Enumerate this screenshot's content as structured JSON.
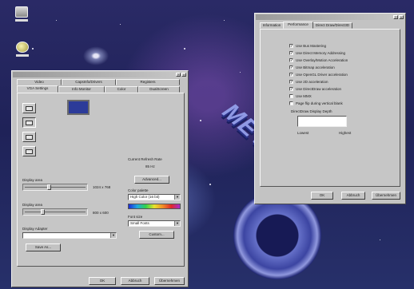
{
  "desktop": {
    "icons": [
      {
        "name": "my-computer-icon"
      },
      {
        "name": "network-icon"
      }
    ],
    "logo_text": "MEVO"
  },
  "display_window": {
    "tabs_row1": [
      "Video",
      "CapsInfo/Drivers",
      "Registers"
    ],
    "tabs_row2": [
      "VGA Settings",
      "Info Monitor",
      "Color",
      "DualScreen"
    ],
    "palette_label": "Display area",
    "resolution_value": "1024 x 768",
    "refresh_label": "Current Refresh Rate",
    "refresh_value": "85 Hz",
    "advanced_button": "Advanced...",
    "font_size_label": "Display area",
    "font_value": "800 x 600",
    "color_palette_label": "Color palette",
    "color_palette_value": "High Color (16 bit)",
    "font_size_select_label": "Font size",
    "font_size_value": "Small Fonts",
    "custom_button": "Custom...",
    "display_adapter_label": "Display Adapter",
    "save_button": "Save As...",
    "ok_button": "OK",
    "cancel_button": "Abbruch",
    "apply_button": "Übernehmen"
  },
  "perf_window": {
    "tabs": [
      "Information",
      "Performance",
      "Direct Draw/Direct3D"
    ],
    "options": [
      {
        "label": "Use Bus Mastering",
        "checked": true
      },
      {
        "label": "Use Direct Memory Addressing",
        "checked": true
      },
      {
        "label": "Use Overlay/Motion Acceleration",
        "checked": true
      },
      {
        "label": "Use Bitmap acceleration",
        "checked": true
      },
      {
        "label": "Use OpenGL Driver acceleration",
        "checked": true
      },
      {
        "label": "Use 2D acceleration",
        "checked": true
      },
      {
        "label": "Use DirectDraw acceleration",
        "checked": true
      },
      {
        "label": "Use MMX",
        "checked": false
      },
      {
        "label": "Page flip during vertical blank",
        "checked": false
      }
    ],
    "speed_label": "DirectDraw Display Depth",
    "speed_left": "Lowest",
    "speed_right": "Highest",
    "ok_button": "OK",
    "cancel_button": "Abbruch",
    "apply_button": "Übernehmen"
  }
}
